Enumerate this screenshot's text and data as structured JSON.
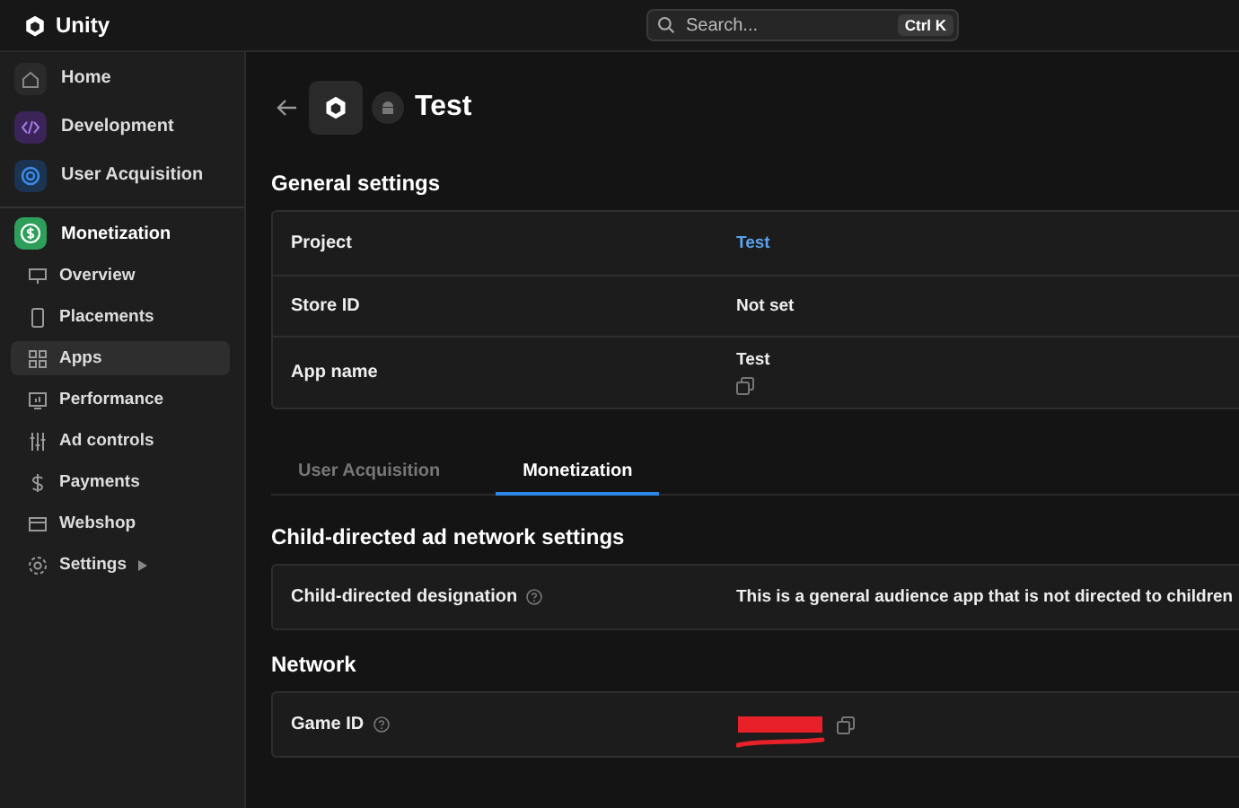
{
  "brand": "Unity",
  "search": {
    "placeholder": "Search...",
    "shortcut": "Ctrl K"
  },
  "sidebar": {
    "sections": [
      {
        "label": "Home",
        "color": "#2a2a2a",
        "selected": false
      },
      {
        "label": "Development",
        "color": "#3a2458",
        "selected": false
      },
      {
        "label": "User Acquisition",
        "color": "#1b3452",
        "selected": false
      }
    ],
    "product": {
      "label": "Monetization",
      "color": "#2e9e5b"
    },
    "items": [
      {
        "label": "Overview",
        "selected": false
      },
      {
        "label": "Placements",
        "selected": false
      },
      {
        "label": "Apps",
        "selected": true
      },
      {
        "label": "Performance",
        "selected": false
      },
      {
        "label": "Ad controls",
        "selected": false
      },
      {
        "label": "Payments",
        "selected": false
      },
      {
        "label": "Webshop",
        "selected": false
      },
      {
        "label": "Settings",
        "selected": false,
        "expandable": true
      }
    ]
  },
  "page": {
    "title": "Test"
  },
  "general_settings": {
    "title": "General settings",
    "rows": [
      {
        "label": "Project",
        "value": "Test",
        "kind": "link"
      },
      {
        "label": "Store ID",
        "value": "Not set",
        "kind": "text"
      },
      {
        "label": "App name",
        "value": "Test",
        "kind": "copy"
      }
    ]
  },
  "tabs": [
    {
      "label": "User Acquisition",
      "selected": false
    },
    {
      "label": "Monetization",
      "selected": true
    }
  ],
  "child_directed": {
    "title": "Child-directed ad network settings",
    "rows": [
      {
        "label": "Child-directed designation",
        "value": "This is a general audience app that is not directed to children",
        "help": true
      }
    ]
  },
  "network": {
    "title": "Network",
    "rows": [
      {
        "label": "Game ID",
        "redacted": true,
        "help": true
      }
    ]
  }
}
